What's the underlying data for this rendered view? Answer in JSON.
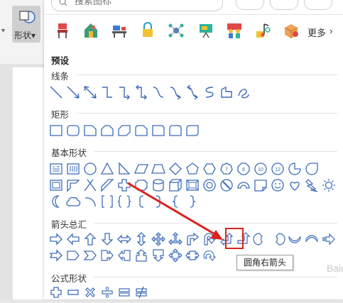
{
  "toolbar": {
    "shape_label": "形状",
    "shape_caret": "▾"
  },
  "search": {
    "placeholder": "搜索图标",
    "pills": [
      "",
      "",
      ""
    ]
  },
  "icon_row": {
    "more_label": "更多",
    "more_chevron": "›"
  },
  "panel": {
    "presets_title": "预设",
    "categories": {
      "lines": "线条",
      "rects": "矩形",
      "basic": "基本形状",
      "arrows": "箭头总汇",
      "formula": "公式形状"
    }
  },
  "tooltip": {
    "text": "圆角右箭头"
  },
  "watermark": {
    "text": "Baidu"
  },
  "colors": {
    "accent": "#3d6cb8",
    "highlight": "#d9231d"
  }
}
